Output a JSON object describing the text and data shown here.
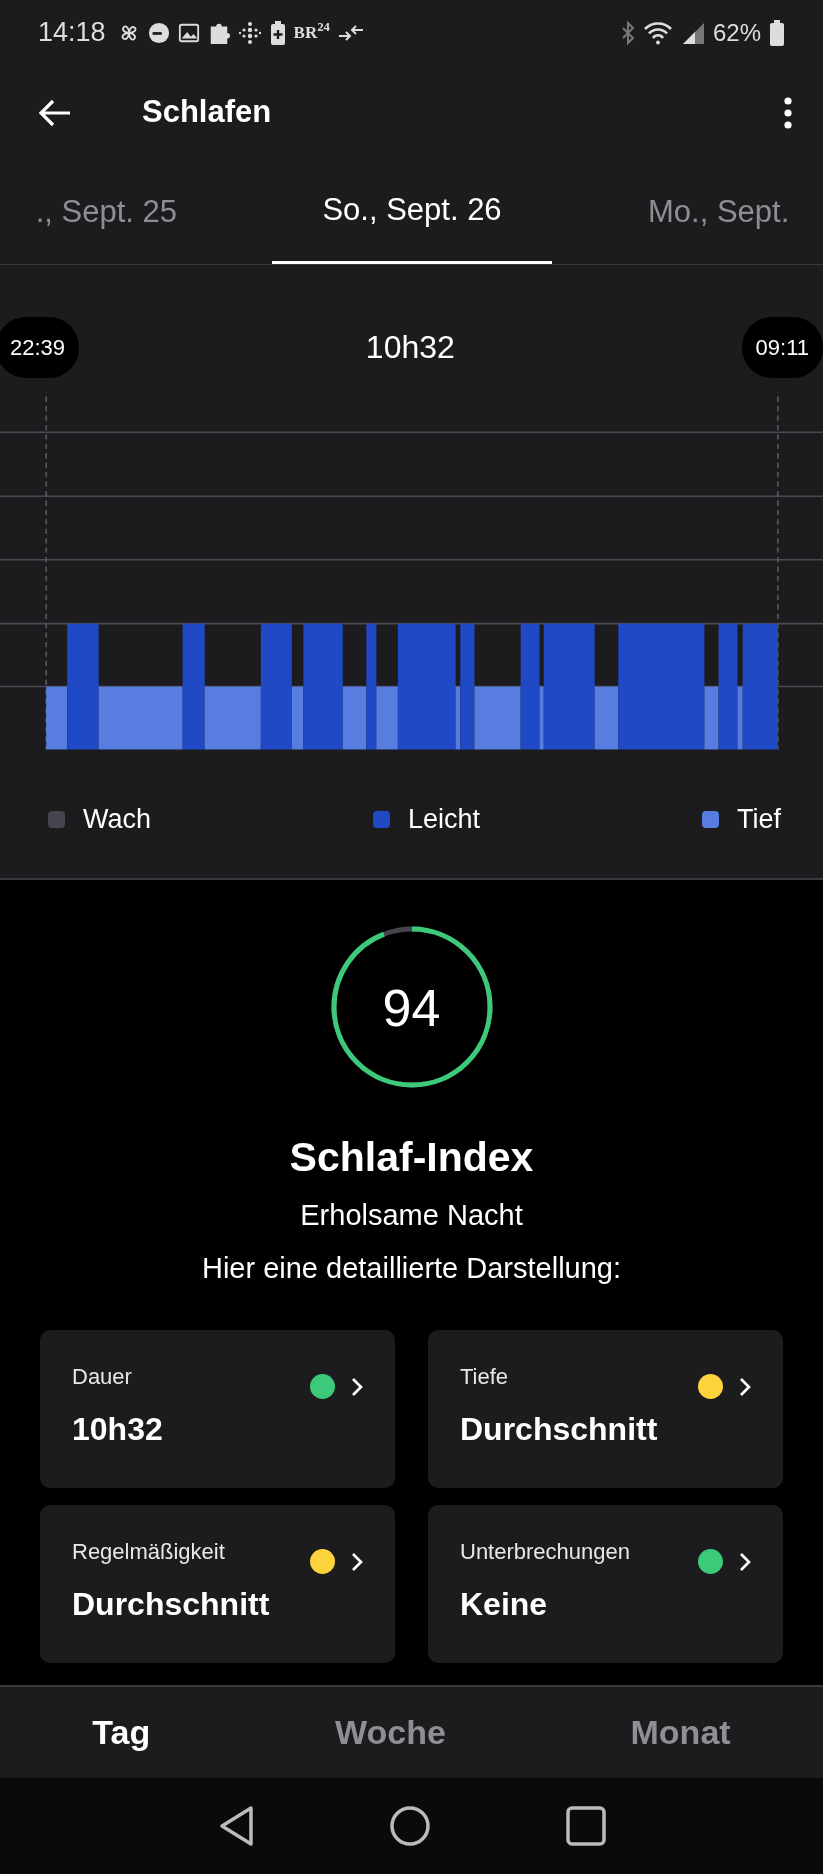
{
  "status_bar": {
    "time": "14:18",
    "radio_logo": "BR$^{24}$",
    "battery": "62%"
  },
  "app_bar": {
    "title": "Schlafen"
  },
  "date_tabs": [
    {
      "label": "., Sept. 25",
      "selected": false
    },
    {
      "label": "So., Sept. 26",
      "selected": true
    },
    {
      "label": "Mo., Sept.",
      "selected": false
    }
  ],
  "sleep_chart": {
    "start": "22:39",
    "duration": "10h32",
    "end": "09:11",
    "legend": [
      {
        "label": "Wach",
        "color": "#45454d"
      },
      {
        "label": "Leicht",
        "color": "#2049c6"
      },
      {
        "label": "Tief",
        "color": "#567ddf"
      }
    ]
  },
  "score": {
    "value": "94",
    "level": 0.94,
    "title": "Schlaf-Index",
    "subtitle": "Erholsame Nacht",
    "description": "Hier eine detaillierte Darstellung:"
  },
  "metrics": [
    {
      "label": "Dauer",
      "value": "10h32",
      "color": "#3cc97a"
    },
    {
      "label": "Tiefe",
      "value": "Durchschnitt",
      "color": "#fcd33c"
    },
    {
      "label": "Regelmäßigkeit",
      "value": "Durchschnitt",
      "color": "#fcd33c"
    },
    {
      "label": "Unterbrechungen",
      "value": "Keine",
      "color": "#3cc97a"
    }
  ],
  "period_tabs": [
    {
      "label": "Tag",
      "selected": true
    },
    {
      "label": "Woche",
      "selected": false
    },
    {
      "label": "Monat",
      "selected": false
    }
  ]
}
